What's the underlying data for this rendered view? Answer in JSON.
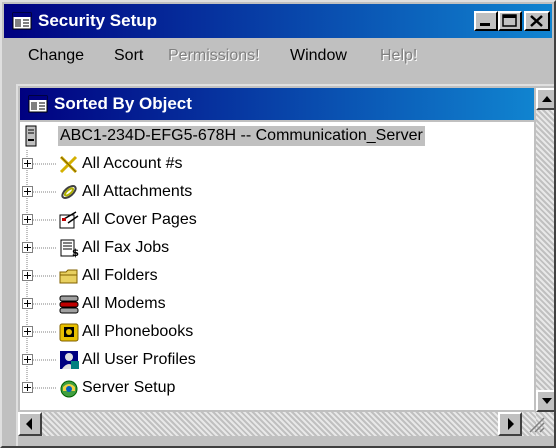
{
  "window": {
    "title": "Security Setup",
    "controls": [
      "minimize",
      "maximize",
      "close"
    ]
  },
  "menu": [
    {
      "label": "Change",
      "enabled": true
    },
    {
      "label": "Sort",
      "enabled": true
    },
    {
      "label": "Permissions!",
      "enabled": false
    },
    {
      "label": "Window",
      "enabled": true
    },
    {
      "label": "Help!",
      "enabled": false
    }
  ],
  "child_window": {
    "title": "Sorted By Object"
  },
  "tree": {
    "root": "ABC1-234D-EFG5-678H -- Communication_Server",
    "nodes": [
      {
        "label": "All Account #s",
        "icon": "account-icon"
      },
      {
        "label": "All Attachments",
        "icon": "attachment-icon"
      },
      {
        "label": "All Cover Pages",
        "icon": "cover-pages-icon"
      },
      {
        "label": "All Fax Jobs",
        "icon": "fax-jobs-icon"
      },
      {
        "label": "All Folders",
        "icon": "folders-icon"
      },
      {
        "label": "All Modems",
        "icon": "modems-icon"
      },
      {
        "label": "All Phonebooks",
        "icon": "phonebooks-icon"
      },
      {
        "label": "All User Profiles",
        "icon": "user-profiles-icon"
      },
      {
        "label": "Server Setup",
        "icon": "server-setup-icon"
      }
    ]
  }
}
